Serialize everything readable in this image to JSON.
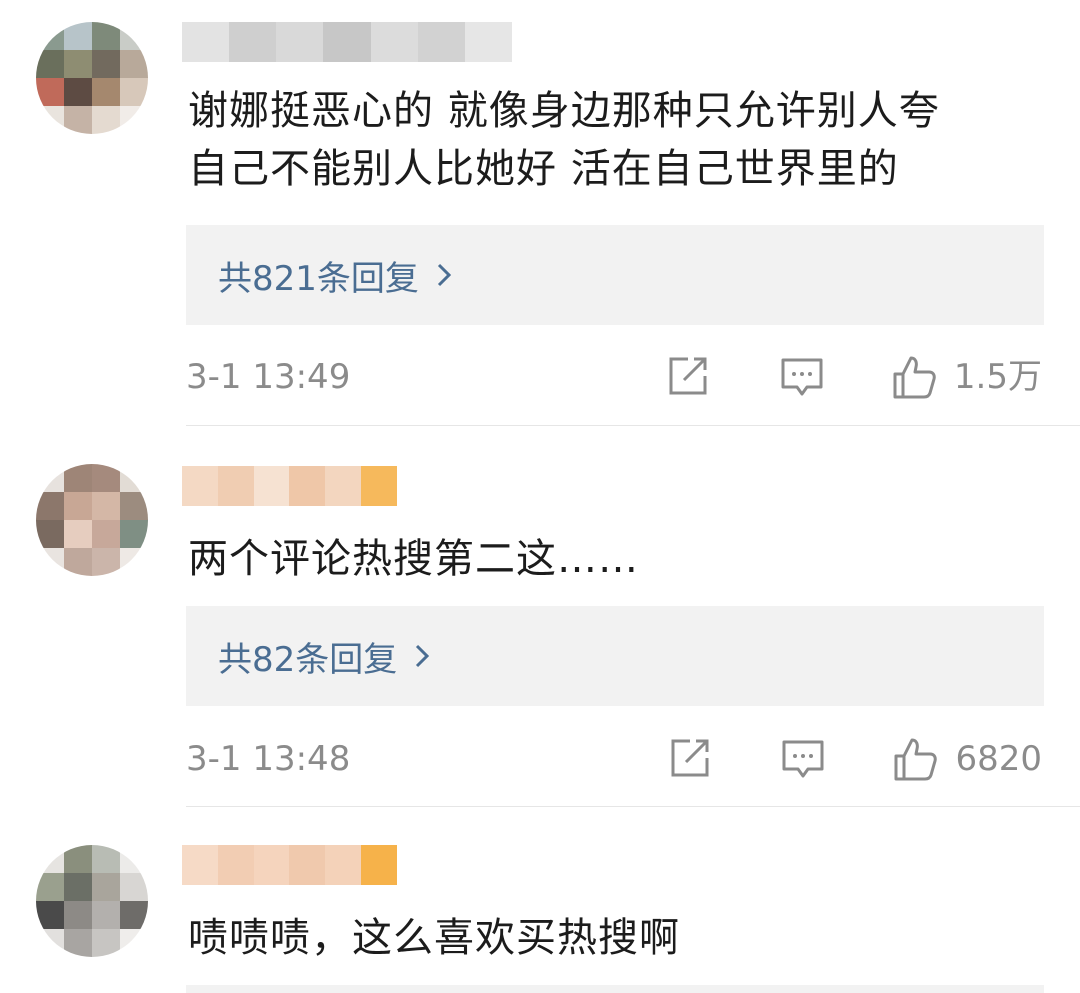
{
  "comments": [
    {
      "text_line1": "谢娜挺恶心的 就像身边那种只允许别人夸",
      "text_line2": "自己不能别人比她好 活在自己世界里的",
      "replies_label": "共821条回复",
      "timestamp": "3-1 13:49",
      "likes": "1.5万"
    },
    {
      "text_line1": "两个评论热搜第二这……",
      "replies_label": "共82条回复",
      "timestamp": "3-1 13:48",
      "likes": "6820"
    },
    {
      "text_line1": "啧啧啧，这么喜欢买热搜啊"
    }
  ],
  "icons": {
    "share": "share-icon",
    "comment": "comment-icon",
    "like": "thumbs-up-icon",
    "reply_arrow": "chevron-right-icon"
  },
  "colors": {
    "reply_link": "#4a6d92",
    "meta_gray": "#8b8b8b",
    "reply_bg": "#f2f2f2"
  }
}
